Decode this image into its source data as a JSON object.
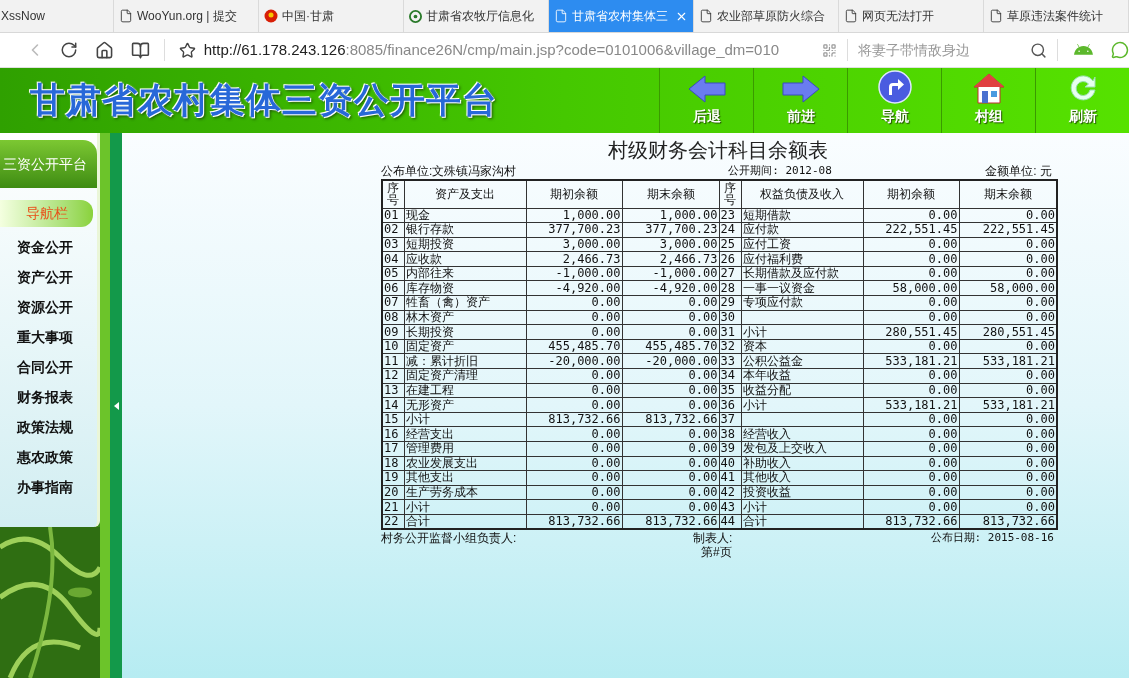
{
  "browser": {
    "tabs": [
      {
        "label": "XssNow",
        "kind": "none",
        "selected": false
      },
      {
        "label": "WooYun.org | 提交",
        "kind": "document",
        "selected": false
      },
      {
        "label": "中国·甘肃",
        "kind": "emblem",
        "selected": false
      },
      {
        "label": "甘肃省农牧厅信息化",
        "kind": "globe",
        "selected": false
      },
      {
        "label": "甘肃省农村集体三",
        "kind": "document",
        "selected": true
      },
      {
        "label": "农业部草原防火综合",
        "kind": "document",
        "selected": false
      },
      {
        "label": "网页无法打开",
        "kind": "document",
        "selected": false
      },
      {
        "label": "草原违法案件统计",
        "kind": "document",
        "selected": false
      }
    ],
    "url_host": "http://61.178.243.126",
    "url_rest": ":8085/finance26N/cmp/main.jsp?code=0101006&village_dm=010",
    "search": {
      "placeholder": "将妻子带情敌身边"
    }
  },
  "header": {
    "title": "甘肃省农村集体三资公开平台",
    "nav_buttons": [
      {
        "label": "后退",
        "kind": "back"
      },
      {
        "label": "前进",
        "kind": "forward"
      },
      {
        "label": "导航",
        "kind": "navigate"
      },
      {
        "label": "村组",
        "kind": "home"
      },
      {
        "label": "刷新",
        "kind": "refresh"
      }
    ]
  },
  "sidebar": {
    "title": "三资公开平台",
    "nav_label": "导航栏",
    "items": [
      "资金公开",
      "资产公开",
      "资源公开",
      "重大事项",
      "合同公开",
      "财务报表",
      "政策法规",
      "惠农政策",
      "办事指南"
    ]
  },
  "report": {
    "title": "村级财务会计科目余额表",
    "unit": "公布单位:文殊镇冯家沟村",
    "period": "公开期间: 2012-08",
    "currency": "金额单位: 元",
    "columns": [
      "序号",
      "资产及支出",
      "期初余额",
      "期末余额",
      "序号",
      "权益负债及收入",
      "期初余额",
      "期末余额"
    ],
    "rows": [
      {
        "l": {
          "no": "01",
          "item": "现金",
          "open": "1,000.00",
          "close": "1,000.00"
        },
        "r": {
          "no": "23",
          "item": "短期借款",
          "open": "0.00",
          "close": "0.00"
        }
      },
      {
        "l": {
          "no": "02",
          "item": "银行存款",
          "open": "377,700.23",
          "close": "377,700.23"
        },
        "r": {
          "no": "24",
          "item": "应付款",
          "open": "222,551.45",
          "close": "222,551.45"
        }
      },
      {
        "l": {
          "no": "03",
          "item": "短期投资",
          "open": "3,000.00",
          "close": "3,000.00"
        },
        "r": {
          "no": "25",
          "item": "应付工资",
          "open": "0.00",
          "close": "0.00"
        }
      },
      {
        "l": {
          "no": "04",
          "item": "应收款",
          "open": "2,466.73",
          "close": "2,466.73"
        },
        "r": {
          "no": "26",
          "item": "应付福利费",
          "open": "0.00",
          "close": "0.00"
        }
      },
      {
        "l": {
          "no": "05",
          "item": "内部往来",
          "open": "-1,000.00",
          "close": "-1,000.00"
        },
        "r": {
          "no": "27",
          "item": "长期借款及应付款",
          "open": "0.00",
          "close": "0.00"
        }
      },
      {
        "l": {
          "no": "06",
          "item": "库存物资",
          "open": "-4,920.00",
          "close": "-4,920.00"
        },
        "r": {
          "no": "28",
          "item": "一事一议资金",
          "open": "58,000.00",
          "close": "58,000.00"
        }
      },
      {
        "l": {
          "no": "07",
          "item": "牲畜（禽）资产",
          "open": "0.00",
          "close": "0.00"
        },
        "r": {
          "no": "29",
          "item": "专项应付款",
          "open": "0.00",
          "close": "0.00"
        }
      },
      {
        "l": {
          "no": "08",
          "item": "林木资产",
          "open": "0.00",
          "close": "0.00"
        },
        "r": {
          "no": "30",
          "open": "0.00",
          "close": "0.00"
        }
      },
      {
        "l": {
          "no": "09",
          "item": "长期投资",
          "open": "0.00",
          "close": "0.00"
        },
        "r": {
          "no": "31",
          "item": "小计",
          "open": "280,551.45",
          "close": "280,551.45"
        }
      },
      {
        "l": {
          "no": "10",
          "item": "固定资产",
          "open": "455,485.70",
          "close": "455,485.70"
        },
        "r": {
          "no": "32",
          "item": "资本",
          "open": "0.00",
          "close": "0.00"
        }
      },
      {
        "l": {
          "no": "11",
          "item": "减：累计折旧",
          "open": "-20,000.00",
          "close": "-20,000.00"
        },
        "r": {
          "no": "33",
          "item": "公积公益金",
          "open": "533,181.21",
          "close": "533,181.21"
        }
      },
      {
        "l": {
          "no": "12",
          "item": "固定资产清理",
          "open": "0.00",
          "close": "0.00"
        },
        "r": {
          "no": "34",
          "item": "本年收益",
          "open": "0.00",
          "close": "0.00"
        }
      },
      {
        "l": {
          "no": "13",
          "item": "在建工程",
          "open": "0.00",
          "close": "0.00"
        },
        "r": {
          "no": "35",
          "item": "收益分配",
          "open": "0.00",
          "close": "0.00"
        }
      },
      {
        "l": {
          "no": "14",
          "item": "无形资产",
          "open": "0.00",
          "close": "0.00"
        },
        "r": {
          "no": "36",
          "item": "小计",
          "open": "533,181.21",
          "close": "533,181.21"
        }
      },
      {
        "l": {
          "no": "15",
          "item": "小计",
          "open": "813,732.66",
          "close": "813,732.66"
        },
        "r": {
          "no": "37",
          "open": "0.00",
          "close": "0.00"
        }
      },
      {
        "l": {
          "no": "16",
          "item": "经营支出",
          "open": "0.00",
          "close": "0.00"
        },
        "r": {
          "no": "38",
          "item": "经营收入",
          "open": "0.00",
          "close": "0.00"
        }
      },
      {
        "l": {
          "no": "17",
          "item": "管理费用",
          "open": "0.00",
          "close": "0.00"
        },
        "r": {
          "no": "39",
          "item": "发包及上交收入",
          "open": "0.00",
          "close": "0.00"
        }
      },
      {
        "l": {
          "no": "18",
          "item": "农业发展支出",
          "open": "0.00",
          "close": "0.00"
        },
        "r": {
          "no": "40",
          "item": "补助收入",
          "open": "0.00",
          "close": "0.00"
        }
      },
      {
        "l": {
          "no": "19",
          "item": "其他支出",
          "open": "0.00",
          "close": "0.00"
        },
        "r": {
          "no": "41",
          "item": "其他收入",
          "open": "0.00",
          "close": "0.00"
        }
      },
      {
        "l": {
          "no": "20",
          "item": "生产劳务成本",
          "open": "0.00",
          "close": "0.00"
        },
        "r": {
          "no": "42",
          "item": "投资收益",
          "open": "0.00",
          "close": "0.00"
        }
      },
      {
        "l": {
          "no": "21",
          "item": "小计",
          "open": "0.00",
          "close": "0.00"
        },
        "r": {
          "no": "43",
          "item": "小计",
          "open": "0.00",
          "close": "0.00"
        }
      },
      {
        "l": {
          "no": "22",
          "item": "合计",
          "open": "813,732.66",
          "close": "813,732.66"
        },
        "r": {
          "no": "44",
          "item": "合计",
          "open": "813,732.66",
          "close": "813,732.66"
        }
      }
    ],
    "supervisor": "村务公开监督小组负责人:",
    "preparer": "制表人:",
    "date": "公布日期: 2015-08-16",
    "page": "第#页"
  }
}
